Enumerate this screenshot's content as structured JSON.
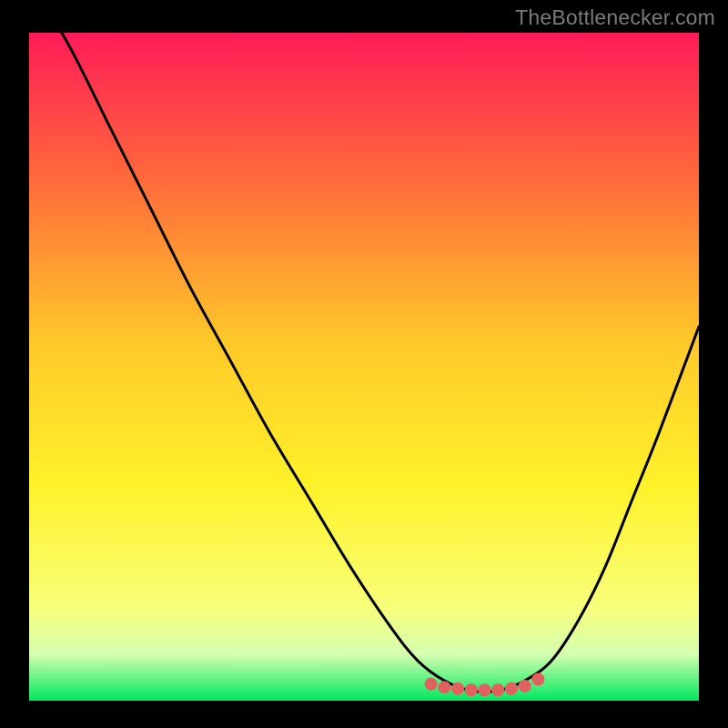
{
  "attribution": "TheBottlenecker.com",
  "colors": {
    "frame": "#000000",
    "attribution_text": "#7a7a7a",
    "gradient_top": "#ff1b57",
    "gradient_mid_upper": "#ff6a3b",
    "gradient_mid": "#ffc82a",
    "gradient_mid_lower": "#fff22a",
    "gradient_lower": "#f8ff7a",
    "gradient_band": "#d6ffb0",
    "gradient_bottom": "#00e860",
    "curve": "#000000",
    "marker": "#e16060"
  },
  "chart_data": {
    "type": "line",
    "title": "",
    "xlabel": "",
    "ylabel": "",
    "xlim": [
      0,
      100
    ],
    "ylim": [
      0,
      100
    ],
    "series": [
      {
        "name": "bottleneck-curve",
        "x": [
          0,
          6,
          12,
          18,
          24,
          30,
          36,
          42,
          48,
          54,
          58,
          62,
          66,
          70,
          74,
          78,
          82,
          86,
          90,
          94,
          100
        ],
        "y": [
          108,
          98,
          86,
          74,
          62,
          51,
          40,
          30,
          20,
          11,
          6,
          3,
          1.5,
          1.5,
          3,
          6,
          12,
          20,
          30,
          40,
          56
        ]
      }
    ],
    "markers": {
      "name": "optimal-range",
      "points": [
        {
          "x": 60,
          "y": 2.5
        },
        {
          "x": 62,
          "y": 2.0
        },
        {
          "x": 64,
          "y": 1.8
        },
        {
          "x": 66,
          "y": 1.6
        },
        {
          "x": 68,
          "y": 1.6
        },
        {
          "x": 70,
          "y": 1.6
        },
        {
          "x": 72,
          "y": 1.8
        },
        {
          "x": 74,
          "y": 2.2
        },
        {
          "x": 76,
          "y": 3.2
        }
      ]
    }
  }
}
